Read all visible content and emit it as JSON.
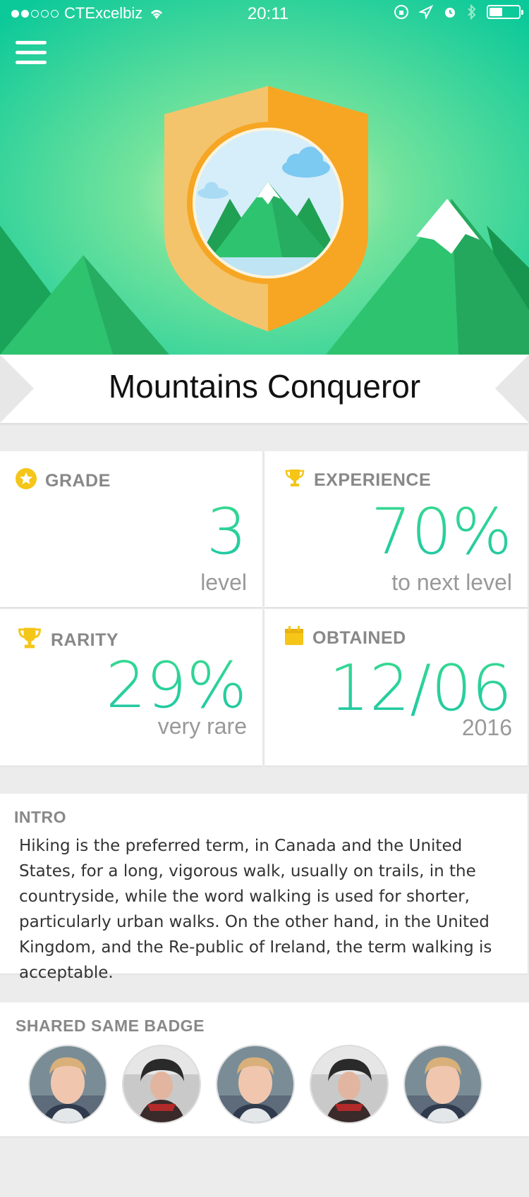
{
  "status_bar": {
    "carrier": "CTExcelbiz",
    "time": "20:11",
    "signal_dots_filled": 2,
    "signal_dots_total": 5,
    "battery_level": 0.4
  },
  "header": {
    "menu_icon": "hamburger-menu-icon",
    "badge_icon": "mountain-shield-badge"
  },
  "badge": {
    "title": "Mountains Conqueror"
  },
  "stats": {
    "grade": {
      "label": "GRADE",
      "icon": "star-icon",
      "value": "3",
      "sub": "level"
    },
    "experience": {
      "label": "EXPERIENCE",
      "icon": "trophy-icon",
      "value": "70%",
      "sub": "to next level"
    },
    "rarity": {
      "label": "RARITY",
      "icon": "trophy-icon",
      "value": "29%",
      "sub": "very rare"
    },
    "obtained": {
      "label": "OBTAINED",
      "icon": "calendar-icon",
      "value": "12/06",
      "sub": "2016"
    }
  },
  "intro": {
    "label": "INTRO",
    "text": "Hiking is the preferred term, in Canada and the United States, for a long, vigorous walk, usually on trails, in the countryside, while the word walking is used for shorter, particularly urban walks. On the other hand, in the United Kingdom, and the Re-public of Ireland, the term walking is acceptable."
  },
  "shared": {
    "label": "SHARED SAME BADGE",
    "avatars": [
      "avatar-man",
      "avatar-woman",
      "avatar-man",
      "avatar-woman",
      "avatar-man"
    ]
  },
  "colors": {
    "accent_green": "#2fd39a",
    "hero_green": "#1fd18f",
    "shield_gold": "#f6a623",
    "star_yellow": "#f5c518"
  }
}
